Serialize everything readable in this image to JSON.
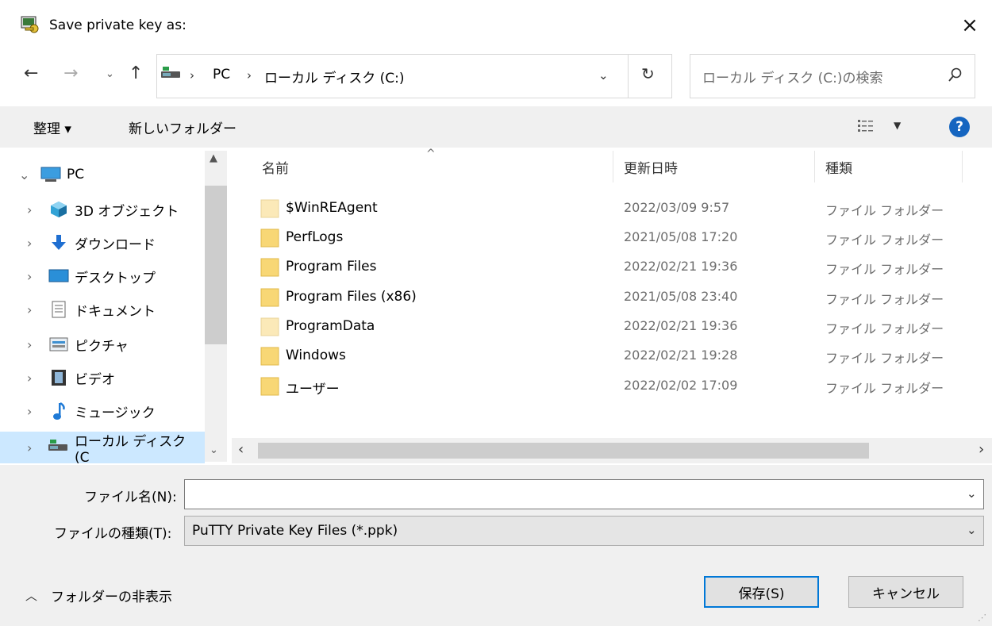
{
  "window": {
    "title": "Save private key as:",
    "close_label": "×"
  },
  "address": {
    "breadcrumb": [
      "PC",
      "ローカル ディスク (C:)"
    ],
    "search_placeholder": "ローカル ディスク (C:)の検索"
  },
  "toolbar": {
    "organize_label": "整理 ▾",
    "new_folder_label": "新しいフォルダー",
    "help_label": "?"
  },
  "nav": {
    "items": [
      {
        "label": "PC",
        "icon": "pc-icon"
      },
      {
        "label": "3D オブジェクト",
        "icon": "3d-objects-icon"
      },
      {
        "label": "ダウンロード",
        "icon": "download-icon"
      },
      {
        "label": "デスクトップ",
        "icon": "desktop-icon"
      },
      {
        "label": "ドキュメント",
        "icon": "document-icon"
      },
      {
        "label": "ピクチャ",
        "icon": "pictures-icon"
      },
      {
        "label": "ビデオ",
        "icon": "video-icon"
      },
      {
        "label": "ミュージック",
        "icon": "music-icon"
      },
      {
        "label": "ローカル ディスク (C",
        "icon": "local-disk-icon"
      }
    ]
  },
  "filelist": {
    "columns": [
      "名前",
      "更新日時",
      "種類"
    ],
    "rows": [
      {
        "name": "$WinREAgent",
        "date": "2022/03/09 9:57",
        "type": "ファイル フォルダー",
        "faded": true
      },
      {
        "name": "PerfLogs",
        "date": "2021/05/08 17:20",
        "type": "ファイル フォルダー",
        "faded": false
      },
      {
        "name": "Program Files",
        "date": "2022/02/21 19:36",
        "type": "ファイル フォルダー",
        "faded": false
      },
      {
        "name": "Program Files (x86)",
        "date": "2021/05/08 23:40",
        "type": "ファイル フォルダー",
        "faded": false
      },
      {
        "name": "ProgramData",
        "date": "2022/02/21 19:36",
        "type": "ファイル フォルダー",
        "faded": true
      },
      {
        "name": "Windows",
        "date": "2022/02/21 19:28",
        "type": "ファイル フォルダー",
        "faded": false
      },
      {
        "name": "ユーザー",
        "date": "2022/02/02 17:09",
        "type": "ファイル フォルダー",
        "faded": false
      }
    ]
  },
  "form": {
    "filename_label": "ファイル名(N):",
    "filename_value": "",
    "filetype_label": "ファイルの種類(T):",
    "filetype_value": "PuTTY Private Key Files (*.ppk)",
    "hide_folders_label": "フォルダーの非表示",
    "save_label": "保存(S)",
    "cancel_label": "キャンセル"
  },
  "colors": {
    "selection": "#cce8ff",
    "folder": "#f8d775",
    "accent": "#0078d7"
  }
}
